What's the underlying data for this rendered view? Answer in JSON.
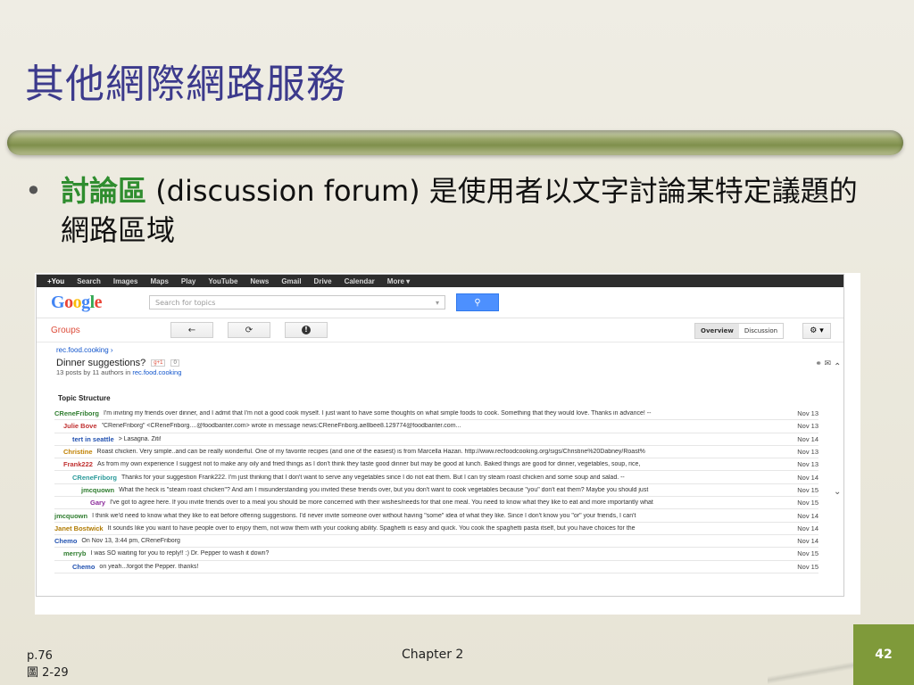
{
  "slide": {
    "title": "其他網際網路服務",
    "bullet": {
      "keyword": "討論區",
      "text": " (discussion forum) 是使用者以文字討論某特定議題的網路區域"
    },
    "footer": {
      "page_ref": "p.76",
      "figure": "圖 2-29",
      "chapter": "Chapter 2",
      "page_number": "42"
    }
  },
  "screenshot": {
    "gbar": [
      "+You",
      "Search",
      "Images",
      "Maps",
      "Play",
      "YouTube",
      "News",
      "Gmail",
      "Drive",
      "Calendar",
      "More ▾"
    ],
    "logo": "Google",
    "search_placeholder": "Search for topics",
    "search_button_icon": "search-icon",
    "groups_label": "Groups",
    "toolbar": {
      "back": "←",
      "refresh": "⟳",
      "report": "!"
    },
    "view_toggle": {
      "overview": "Overview",
      "discussion": "Discussion"
    },
    "gear": "⚙ ▾",
    "topic": {
      "breadcrumb": "rec.food.cooking ›",
      "subject": "Dinner suggestions?",
      "gplus": "g+1",
      "count": "0",
      "meta_prefix": "13 posts by 11 authors in ",
      "meta_group": "rec.food.cooking"
    },
    "topic_structure_label": "Topic Structure",
    "posts": [
      {
        "author": "CReneFriborg",
        "color": "#2f7d2f",
        "indent": 0,
        "text": "I'm inviting my friends over dinner, and I admit that I'm not a good cook myself. I just want to have some thoughts on what simple foods to cook. Something that they would love. Thanks in advance! --",
        "date": "Nov 13"
      },
      {
        "author": "Julie Bove",
        "color": "#c03030",
        "indent": 10,
        "text": "\"CReneFriborg\" <CReneFriborg....@foodbanter.com> wrote in message news:CReneFriborg.ae8bee8.129774@foodbanter.com...",
        "date": "Nov 13"
      },
      {
        "author": "tert in seattle",
        "color": "#2050b0",
        "indent": 20,
        "text": "> Lasagna. Ziti!",
        "date": "Nov 14"
      },
      {
        "author": "Christine",
        "color": "#c08000",
        "indent": 10,
        "text": "Roast chicken.  Very simple..and can be really wonderful. One of my favorite recipes (and one of the easiest) is from Marcella Hazan. http://www.recfoodcooking.org/sigs/Christine%20Dabney/Roast%",
        "date": "Nov 13"
      },
      {
        "author": "Frank222",
        "color": "#c03030",
        "indent": 10,
        "text": "As from my own experience I suggest not to make any oily and fried things as I don't think they taste good dinner but may be good at lunch. Baked things are good for dinner, vegetables, soup, rice,",
        "date": "Nov 13"
      },
      {
        "author": "CReneFriborg",
        "color": "#2a9a9a",
        "indent": 20,
        "text": "Thanks for your suggestion Frank222. I'm just thinking that I don't want to serve any vegetables since I do not eat them. But I can try steam roast chicken and some soup and salad. --",
        "date": "Nov 14"
      },
      {
        "author": "jmcquown",
        "color": "#2f7d2f",
        "indent": 30,
        "text": "What the heck is \"steam roast chicken\"? And am I misunderstanding you invited these friends over, but you don't want to cook vegetables because \"you\" don't eat them?  Maybe you should just",
        "date": "Nov 15"
      },
      {
        "author": "Gary",
        "color": "#8a2a9a",
        "indent": 40,
        "text": "I've got to agree here. If you invite friends over to a meal you should be more concerned with their wishes/needs for that one meal.  You need to know what they like to eat and more importantly what",
        "date": "Nov 15"
      },
      {
        "author": "jmcquown",
        "color": "#2f7d2f",
        "indent": 0,
        "text": "I think we'd need to know what they like to eat before offering suggestions.  I'd never invite someone over without having \"some\" idea of what they like.  Since I don't know you \"or\" your friends, I can't",
        "date": "Nov 14"
      },
      {
        "author": "Janet Bostwick",
        "color": "#b07a00",
        "indent": 0,
        "text": "It sounds like you want to have people over to enjoy them, not wow them with your cooking ability. Spaghetti is easy and quick.  You cook the spaghetti pasta itself, but you have choices for the",
        "date": "Nov 14"
      },
      {
        "author": "Chemo",
        "color": "#2050b0",
        "indent": 0,
        "text": "On Nov 13, 3:44 pm, CReneFriborg",
        "date": "Nov 14"
      },
      {
        "author": "merryb",
        "color": "#2f7d2f",
        "indent": 10,
        "text": "I was SO waiting for you to reply!! :) Dr. Pepper to wash it down?",
        "date": "Nov 15"
      },
      {
        "author": "Chemo",
        "color": "#2050b0",
        "indent": 20,
        "text": "on yeah...forgot the Pepper. thanks!",
        "date": "Nov 15"
      }
    ]
  }
}
